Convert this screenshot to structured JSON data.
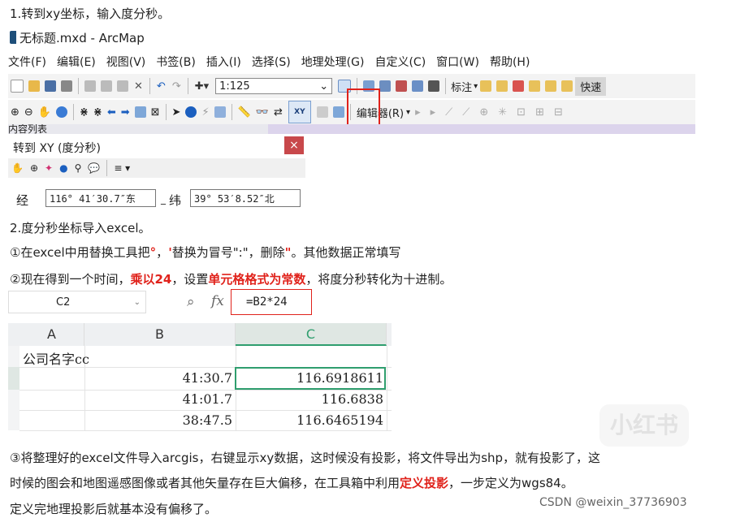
{
  "step1": "1.转到xy坐标，输入度分秒。",
  "arcmap": {
    "title": "无标题.mxd - ArcMap",
    "menu": [
      "文件(F)",
      "编辑(E)",
      "视图(V)",
      "书签(B)",
      "插入(I)",
      "选择(S)",
      "地理处理(G)",
      "自定义(C)",
      "窗口(W)",
      "帮助(H)"
    ],
    "scale": "1:125",
    "label_tool": "标注",
    "quick": "快速",
    "editor": "编辑器(R)",
    "xy_button": "XY",
    "toc_title": "内容列表",
    "accent": "#e0221b"
  },
  "goto_dialog": {
    "title": "转到 XY   (度分秒)",
    "close": "×",
    "lon_label": "经",
    "lon_value": "116° 41′30.7″东",
    "lat_label": "纬",
    "lat_value": "39° 53′8.52″北"
  },
  "step2": "2.度分秒坐标导入excel。",
  "step2_1": {
    "a": "①在excel中用替换工具把",
    "b": "°",
    "c": "，",
    "d": "'",
    "e": "替换为冒号\":\"，删除",
    "f": "\"",
    "g": "。其他数据正常填写"
  },
  "step2_2": {
    "a": "②现在得到一个时间，",
    "b": "乘以24",
    "c": "，设置",
    "d": "单元格格式为常数",
    "e": "，将度分秒转化为十进制。"
  },
  "excel": {
    "namebox": "C2",
    "fx": "fx",
    "formula": "=B2*24",
    "columns": [
      "A",
      "B",
      "C"
    ],
    "header_row": "公司名字cc",
    "rows": [
      {
        "b": "41:30.7",
        "c": "116.6918611"
      },
      {
        "b": "41:01.7",
        "c": "116.6838"
      },
      {
        "b": "38:47.5",
        "c": "116.6465194"
      }
    ]
  },
  "step3": {
    "line1": "③将整理好的excel文件导入arcgis，右键显示xy数据，这时候没有投影，将文件导出为shp，就有投影了，这",
    "line2": "时候的图会和地图遥感图像或者其他矢量存在巨大偏移，在工具箱中利用",
    "line2_red": "定义投影",
    "line2_end": "，一步定义为wgs84。",
    "line3": "定义完地理投影后就基本没有偏移了。"
  },
  "watermark": "小红书",
  "credit": "CSDN @weixin_37736903"
}
